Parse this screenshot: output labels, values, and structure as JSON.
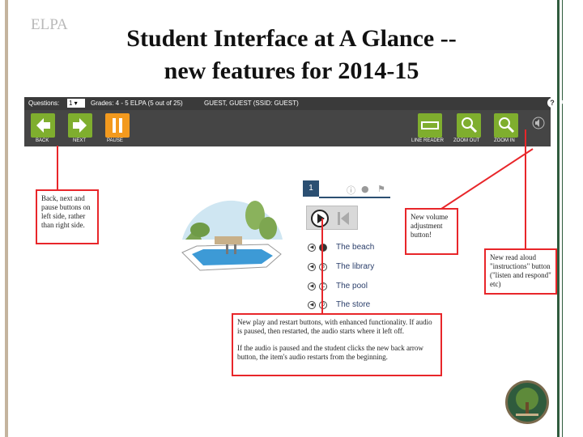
{
  "slide": {
    "corner_label": "ELPA",
    "title_line1": "Student Interface at A Glance --",
    "title_line2": "new features for 2014-15"
  },
  "toolbar": {
    "questions_label": "Questions:",
    "question_value": "1",
    "grade_text": "Grades: 4 - 5 ELPA (5 out of 25)",
    "user_text": "GUEST, GUEST (SSID: GUEST)",
    "buttons": {
      "back": "BACK",
      "next": "NEXT",
      "pause": "PAUSE",
      "line_reader": "LINE READER",
      "zoom_out": "ZOOM OUT",
      "zoom_in": "ZOOM IN"
    },
    "accent_green": "#7fae2e",
    "accent_orange": "#f39a1e",
    "bar_color": "#454545"
  },
  "item": {
    "number": "1",
    "options": [
      "The beach",
      "The library",
      "The pool",
      "The store"
    ],
    "option_letters": [
      "A",
      "B",
      "C",
      "D"
    ]
  },
  "annotations": {
    "buttons_note": "Back, next and pause buttons on left side, rather than right side.",
    "volume_note": "New volume adjustment button!",
    "read_aloud_note": "New read aloud \"instructions\" button (\"listen and respond\" etc)",
    "play_note_p1": "New play and restart buttons, with enhanced functionality. If audio is paused, then restarted, the audio starts where it left off.",
    "play_note_p2": "If the audio is paused and the student clicks the new back arrow button, the item's audio restarts from the beginning.",
    "border_color": "#e8262a"
  }
}
